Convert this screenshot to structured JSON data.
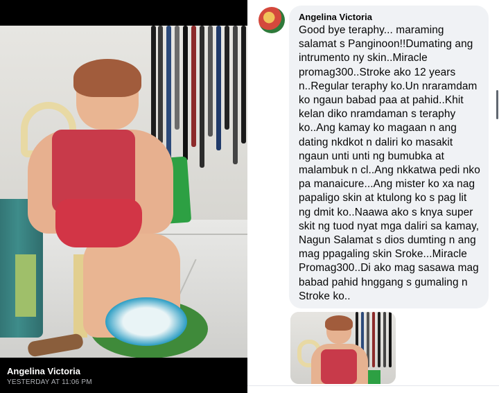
{
  "post": {
    "poster_name": "Angelina Victoria",
    "timestamp": "YESTERDAY AT 11:06 PM"
  },
  "comment": {
    "author": "Angelina Victoria",
    "text": "Good bye teraphy... maraming salamat s Panginoon!!Dumating ang intrumento ny skin..Miracle promag300..Stroke ako 12 years n..Regular teraphy ko.Un nraramdam ko ngaun babad paa at pahid..Khit kelan diko nramdaman s teraphy ko..Ang kamay ko magaan n ang dating nkdkot n daliri ko masakit ngaun unti unti ng bumubka at malambuk n cl..Ang nkkatwa pedi nko pa manaicure...Ang mister ko xa nag papaligo skin at ktulong ko s pag lit ng dmit ko..Naawa ako s knya super skit ng tuod nyat mga daliri sa kamay, Nagun Salamat s dios dumting n ang mag ppagaling skin Sroke...Miracle Promag300..Di ako mag sasawa mag babad pahid hnggang s gumaling n Stroke ko.."
  },
  "colors": {
    "left_bg": "#000000",
    "bubble_bg": "#f0f2f5",
    "text": "#050505",
    "timestamp": "#b0b3b8"
  }
}
